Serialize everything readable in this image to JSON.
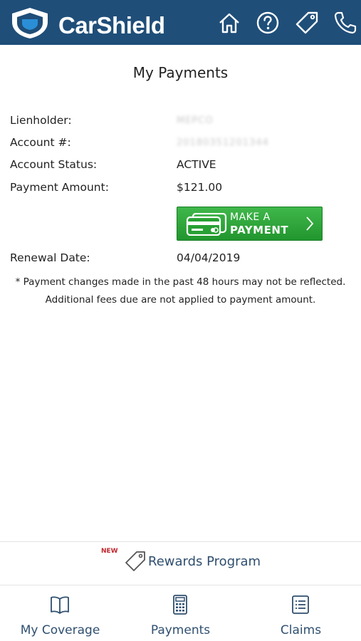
{
  "header": {
    "brand": "CarShield",
    "colors": {
      "bar": "#1f4e79",
      "text": "#ffffff"
    },
    "icons": [
      "home-icon",
      "help-icon",
      "tag-icon",
      "phone-icon"
    ]
  },
  "page_title": "My Payments",
  "details": {
    "lienholder_label": "Lienholder:",
    "lienholder_value": "MEPCO",
    "account_label": "Account #:",
    "account_value": "20180351201344",
    "status_label": "Account Status:",
    "status_value": "ACTIVE",
    "amount_label": "Payment Amount:",
    "amount_value": "$121.00",
    "renewal_label": "Renewal Date:",
    "renewal_value": "04/04/2019"
  },
  "pay_button": {
    "line1": "MAKE A",
    "line2": "PAYMENT",
    "color": "#2ea83a"
  },
  "note": "* Payment changes made in the past 48 hours may not be reflected. Additional fees due are not applied to payment amount.",
  "rewards": {
    "badge": "NEW",
    "label": "Rewards Program"
  },
  "bottom_nav": {
    "items": [
      {
        "label": "My Coverage",
        "icon": "book-icon"
      },
      {
        "label": "Payments",
        "icon": "calculator-icon"
      },
      {
        "label": "Claims",
        "icon": "list-icon"
      }
    ]
  }
}
